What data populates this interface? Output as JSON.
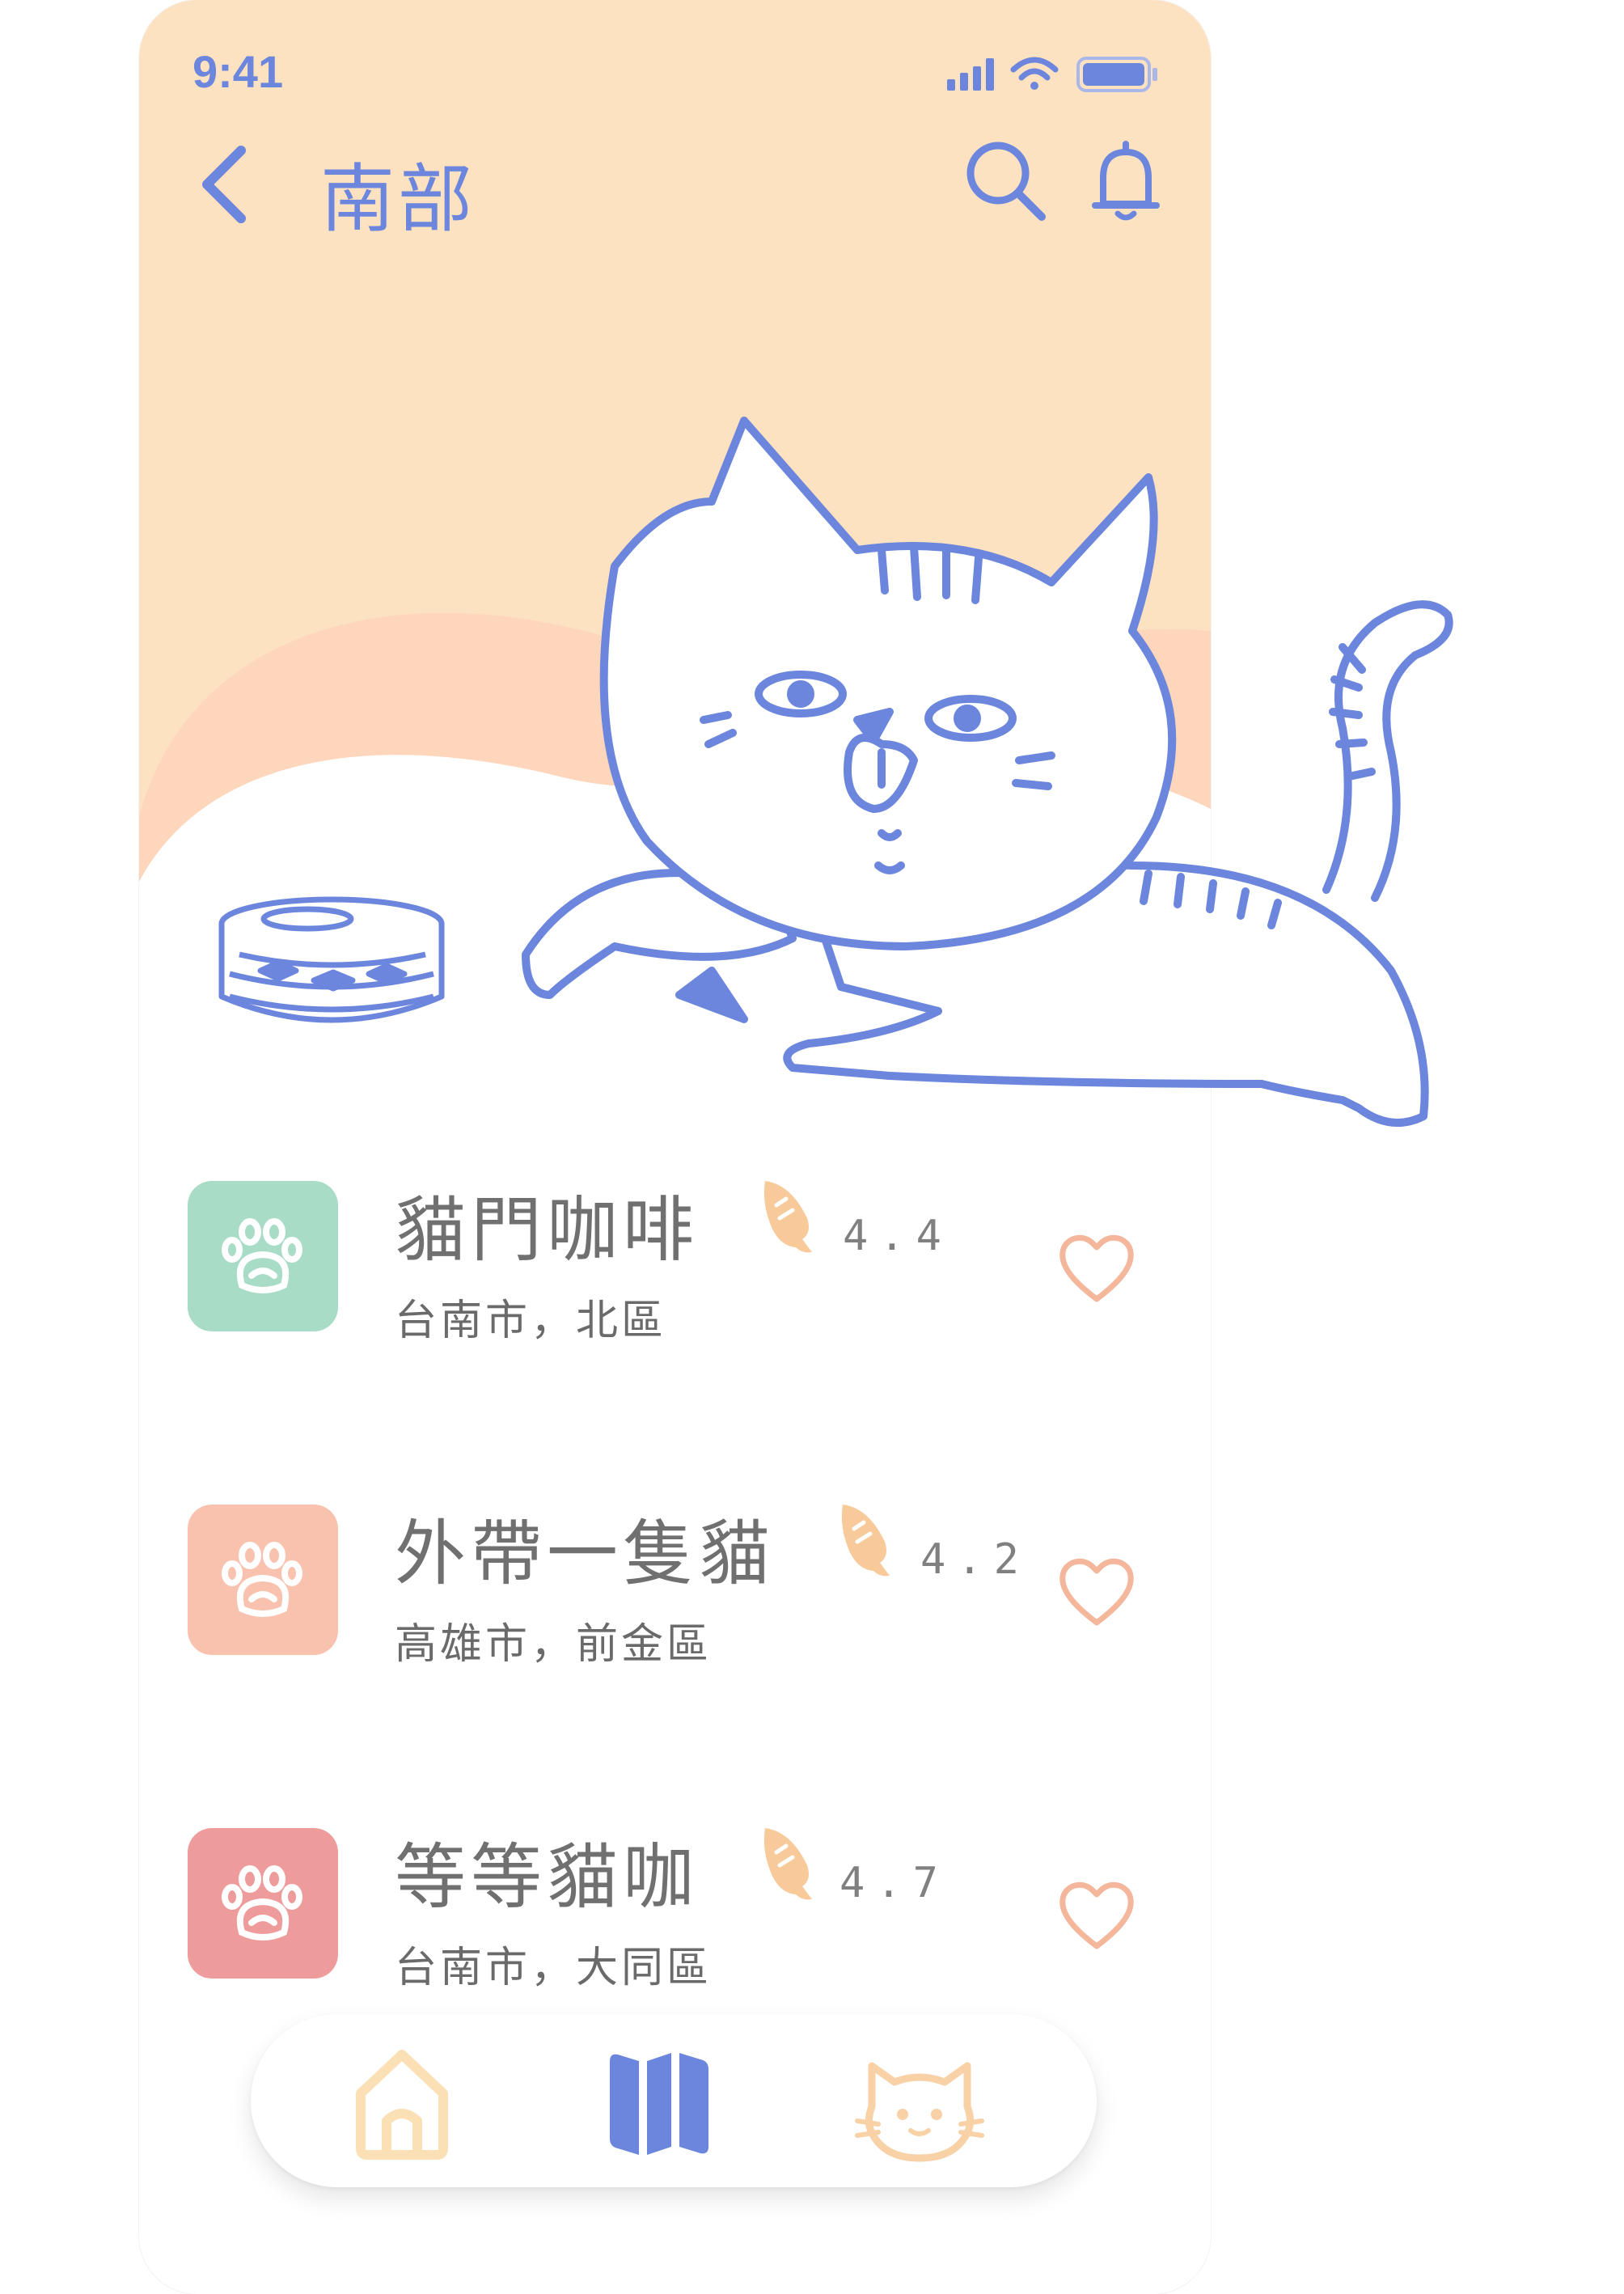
{
  "status_bar": {
    "time": "9:41"
  },
  "nav": {
    "title": "南部"
  },
  "cafes": [
    {
      "name": "貓門咖啡",
      "rating": "4.4",
      "location": "台南市，北區",
      "icon_color": "#a8dcc6"
    },
    {
      "name": "外帶一隻貓",
      "rating": "4.2",
      "location": "高雄市，前金區",
      "icon_color": "#f9c2ae"
    },
    {
      "name": "等等貓咖",
      "rating": "4.7",
      "location": "台南市，大同區",
      "icon_color": "#ee9b9c"
    }
  ],
  "tabbar": {
    "active": "map"
  },
  "colors": {
    "accent": "#6b86dc",
    "hero_bg": "#fde2c1",
    "wave": "#fdd6bc",
    "heart": "#f5b79c",
    "fish": "#f8ca9a",
    "home_tab": "#fbe0b6",
    "cat_tab": "#f8d1a6"
  },
  "icons": {
    "back": "chevron-left-icon",
    "search": "search-icon",
    "bell": "bell-icon",
    "paw": "paw-icon",
    "fish": "fish-icon",
    "heart": "heart-icon",
    "home": "home-icon",
    "map": "map-icon",
    "cat": "cat-icon"
  }
}
